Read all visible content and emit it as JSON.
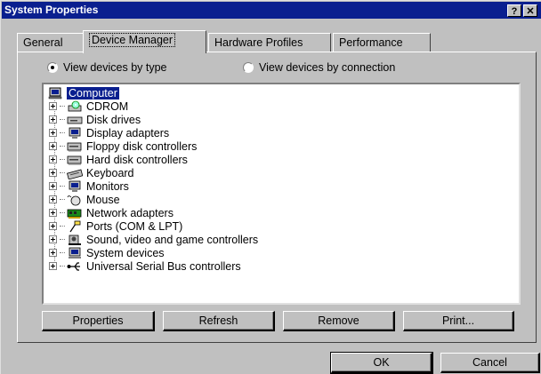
{
  "window": {
    "title": "System Properties",
    "help": "?",
    "close": "✕"
  },
  "tabs": [
    {
      "label": "General"
    },
    {
      "label": "Device Manager"
    },
    {
      "label": "Hardware Profiles"
    },
    {
      "label": "Performance"
    }
  ],
  "view_options": {
    "by_type": "View devices by type",
    "by_connection": "View devices by connection",
    "selected": "by_type"
  },
  "tree": {
    "root": "Computer",
    "items": [
      {
        "label": "CDROM",
        "icon": "cdrom-icon"
      },
      {
        "label": "Disk drives",
        "icon": "disk-drive-icon"
      },
      {
        "label": "Display adapters",
        "icon": "monitor-icon"
      },
      {
        "label": "Floppy disk controllers",
        "icon": "floppy-controller-icon"
      },
      {
        "label": "Hard disk controllers",
        "icon": "hard-disk-controller-icon"
      },
      {
        "label": "Keyboard",
        "icon": "keyboard-icon"
      },
      {
        "label": "Monitors",
        "icon": "monitor-icon"
      },
      {
        "label": "Mouse",
        "icon": "mouse-icon"
      },
      {
        "label": "Network adapters",
        "icon": "network-adapter-icon"
      },
      {
        "label": "Ports (COM & LPT)",
        "icon": "port-icon"
      },
      {
        "label": "Sound, video and game controllers",
        "icon": "sound-icon"
      },
      {
        "label": "System devices",
        "icon": "system-device-icon"
      },
      {
        "label": "Universal Serial Bus controllers",
        "icon": "usb-icon"
      }
    ]
  },
  "buttons": {
    "properties": "Properties",
    "refresh": "Refresh",
    "remove": "Remove",
    "print": "Print...",
    "ok": "OK",
    "cancel": "Cancel"
  },
  "colors": {
    "titlebar": "#0a1f8f",
    "face": "#c0c0c0",
    "selection": "#0a1f8f"
  }
}
